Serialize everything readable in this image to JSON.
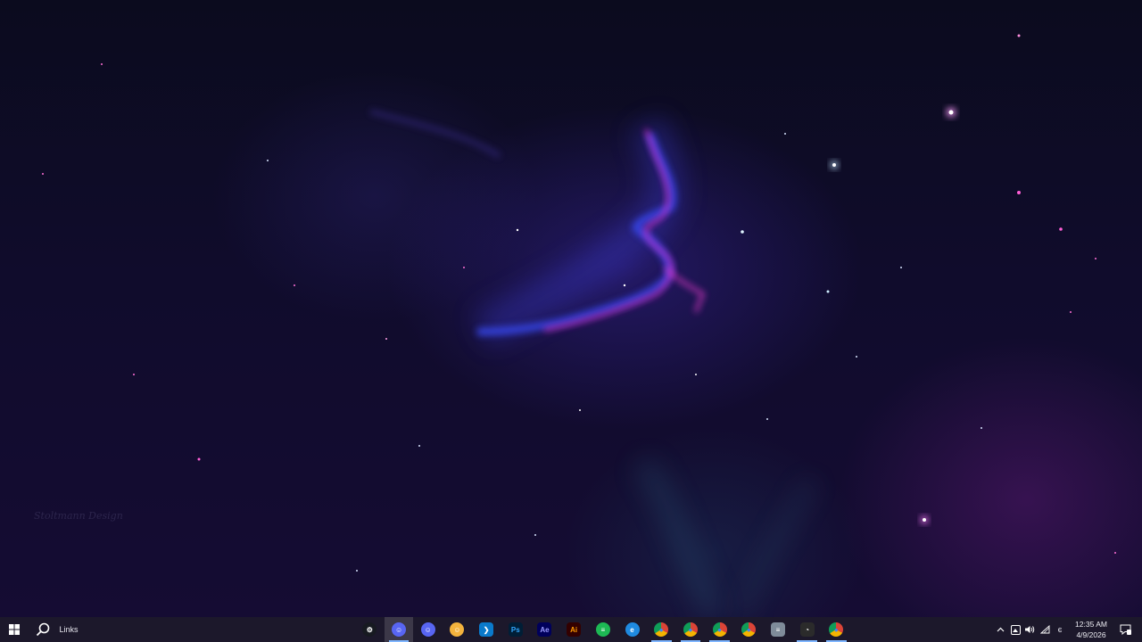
{
  "desktop": {
    "wallpaper": "space nebula",
    "watermark_text": "Stoltmann Design",
    "colors": {
      "nebula_pink": "#ff2fd2",
      "nebula_blue": "#3b4dff",
      "space": "#0e0b25"
    }
  },
  "taskbar": {
    "start_icon": "windows-logo-icon",
    "search_icon": "search-icon",
    "links_label": "Links",
    "apps": [
      {
        "name": "Steam",
        "icon": "steam-icon",
        "open": false,
        "active": false,
        "color": "#171a21",
        "glyph": "⚙"
      },
      {
        "name": "Discord",
        "icon": "discord-icon",
        "open": true,
        "active": true,
        "color": "#5865f2",
        "glyph": "☺"
      },
      {
        "name": "Discord",
        "icon": "discord-icon",
        "open": false,
        "active": false,
        "color": "#5865f2",
        "glyph": "☺"
      },
      {
        "name": "Discord Canary",
        "icon": "discord-canary-icon",
        "open": false,
        "active": false,
        "color": "#f3b33d",
        "glyph": "☺"
      },
      {
        "name": "Visual Studio Code",
        "icon": "vscode-icon",
        "open": false,
        "active": false,
        "color": "#0a7acc",
        "glyph": "❯"
      },
      {
        "name": "Photoshop",
        "icon": "photoshop-icon",
        "open": false,
        "active": false,
        "color": "#001e36",
        "glyph": "Ps"
      },
      {
        "name": "After Effects",
        "icon": "after-effects-icon",
        "open": false,
        "active": false,
        "color": "#00005b",
        "glyph": "Ae"
      },
      {
        "name": "Illustrator",
        "icon": "illustrator-icon",
        "open": false,
        "active": false,
        "color": "#330000",
        "glyph": "Ai"
      },
      {
        "name": "Spotify",
        "icon": "spotify-icon",
        "open": false,
        "active": false,
        "color": "#1db954",
        "glyph": "≡"
      },
      {
        "name": "Microsoft Edge",
        "icon": "edge-icon",
        "open": false,
        "active": false,
        "color": "#1f8ae0",
        "glyph": "e"
      },
      {
        "name": "Chrome",
        "icon": "chrome-icon",
        "open": true,
        "active": false,
        "color": "#db4437",
        "glyph": "●"
      },
      {
        "name": "Chrome",
        "icon": "chrome-icon",
        "open": true,
        "active": false,
        "color": "#db4437",
        "glyph": "●"
      },
      {
        "name": "Chrome",
        "icon": "chrome-icon",
        "open": true,
        "active": false,
        "color": "#db4437",
        "glyph": "●"
      },
      {
        "name": "Chrome",
        "icon": "chrome-icon",
        "open": false,
        "active": false,
        "color": "#f4b400",
        "glyph": "●"
      },
      {
        "name": "Notepad",
        "icon": "notepad-icon",
        "open": false,
        "active": false,
        "color": "#7f8c9a",
        "glyph": "≡"
      },
      {
        "name": "Task Manager",
        "icon": "task-manager-icon",
        "open": true,
        "active": false,
        "color": "#2b2b2b",
        "glyph": "◔"
      },
      {
        "name": "Chrome",
        "icon": "chrome-icon",
        "open": true,
        "active": false,
        "color": "#db4437",
        "glyph": "●"
      }
    ],
    "tray": {
      "chevron_icon": "chevron-up-icon",
      "icons": [
        "onedrive-icon",
        "volume-icon",
        "network-icon",
        "ime-icon"
      ],
      "ime_label": "є",
      "time": "12:35 AM",
      "date": "4/9/2026",
      "notification_icon": "notification-icon"
    }
  }
}
